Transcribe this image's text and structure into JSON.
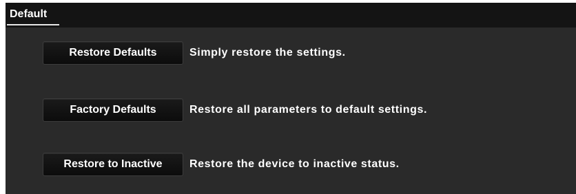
{
  "tab": {
    "label": "Default"
  },
  "actions": [
    {
      "button_label": "Restore Defaults",
      "description": "Simply restore the settings."
    },
    {
      "button_label": "Factory Defaults",
      "description": "Restore all parameters to default settings."
    },
    {
      "button_label": "Restore to Inactive",
      "description": "Restore the device to inactive status."
    }
  ],
  "colors": {
    "panel_background": "#2a2a2a",
    "header_background": "#141414",
    "button_background": "#121212",
    "text": "#ffffff"
  }
}
